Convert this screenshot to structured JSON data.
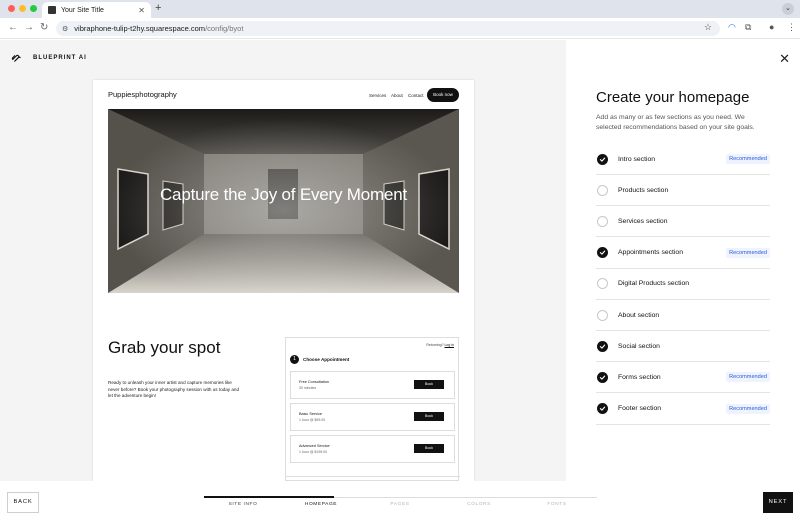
{
  "browser": {
    "tab_title": "Your Site Title",
    "tab_close": "✕",
    "new_tab": "+",
    "url_host": "vibraphone-tulip-t2hy.squarespace.com",
    "url_path": "/config/byot"
  },
  "app": {
    "brand": "BLUEPRINT AI",
    "close": "✕"
  },
  "preview": {
    "site_title": "Puppiesphotography",
    "nav": [
      "Services",
      "About",
      "Contact"
    ],
    "book_button": "Book now",
    "hero_title": "Capture the Joy of Every Moment",
    "section_title": "Grab your spot",
    "section_text": "Ready to unleash your inner artist and capture memories like never before? Book your photography session with us today and let the adventure begin!",
    "booking": {
      "returning_text": "Returning?",
      "login_link": "Log in",
      "step_number": "1",
      "step_label": "Choose Appointment",
      "services": [
        {
          "name": "Free Consultation",
          "meta": "30 minutes",
          "button": "Book"
        },
        {
          "name": "Basic Service",
          "meta": "1 hour @ $99.00",
          "button": "Book"
        },
        {
          "name": "Advanced Service",
          "meta": "1 hour @ $199.00",
          "button": "Book"
        }
      ]
    }
  },
  "panel": {
    "title": "Create your homepage",
    "subtitle": "Add as many or as few sections as you need. We selected recommendations based on your site goals.",
    "recommended_label": "Recommended",
    "sections": [
      {
        "label": "Intro section",
        "checked": true,
        "recommended": true
      },
      {
        "label": "Products section",
        "checked": false,
        "recommended": false
      },
      {
        "label": "Services section",
        "checked": false,
        "recommended": false
      },
      {
        "label": "Appointments section",
        "checked": true,
        "recommended": true
      },
      {
        "label": "Digital Products section",
        "checked": false,
        "recommended": false
      },
      {
        "label": "About section",
        "checked": false,
        "recommended": false
      },
      {
        "label": "Social section",
        "checked": true,
        "recommended": false
      },
      {
        "label": "Forms section",
        "checked": true,
        "recommended": true
      },
      {
        "label": "Footer section",
        "checked": true,
        "recommended": true
      }
    ]
  },
  "footer": {
    "back": "BACK",
    "next": "NEXT",
    "progress_fraction": 0.33,
    "steps": [
      {
        "label": "SITE INFO",
        "state": "done"
      },
      {
        "label": "HOMEPAGE",
        "state": "current"
      },
      {
        "label": "PAGES",
        "state": "todo"
      },
      {
        "label": "COLORS",
        "state": "todo"
      },
      {
        "label": "FONTS",
        "state": "todo"
      }
    ]
  },
  "colors": {
    "accent": "#111111",
    "recommended": "#2a5bd7",
    "panel_bg": "#f4f4f4"
  }
}
